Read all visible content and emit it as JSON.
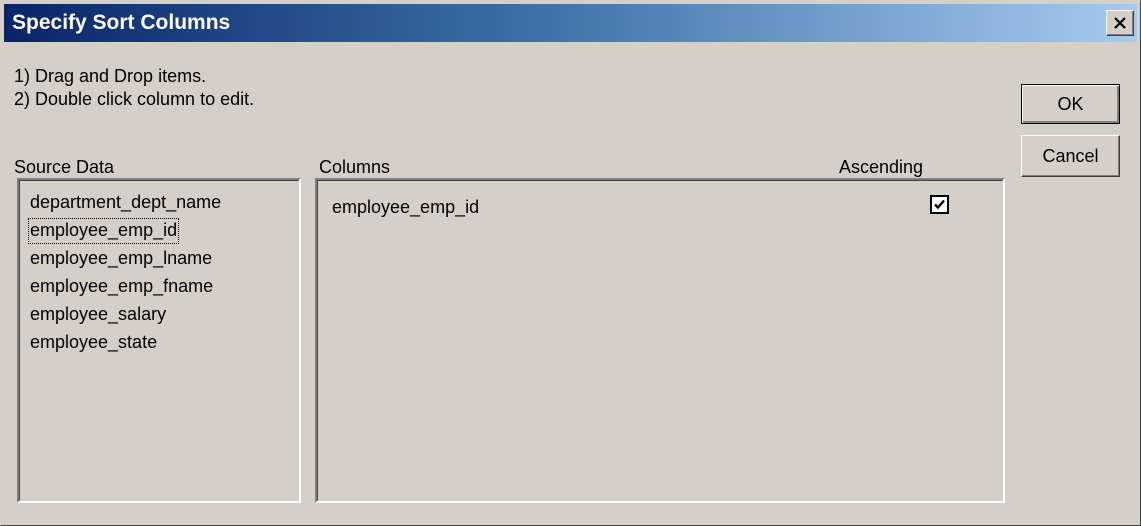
{
  "window": {
    "title": "Specify Sort Columns"
  },
  "instructions": [
    "1) Drag and Drop items.",
    "2) Double click column to edit."
  ],
  "labels": {
    "source_data": "Source Data",
    "columns": "Columns",
    "ascending": "Ascending"
  },
  "source_items": [
    "department_dept_name",
    "employee_emp_id",
    "employee_emp_lname",
    "employee_emp_fname",
    "employee_salary",
    "employee_state"
  ],
  "focused_source_index": 1,
  "sort_columns": [
    {
      "name": "employee_emp_id",
      "ascending": true
    }
  ],
  "buttons": {
    "ok": "OK",
    "cancel": "Cancel"
  },
  "colors": {
    "title_gradient_start": "#0a246a",
    "title_gradient_end": "#a6caf0",
    "face": "#d4d0c8"
  }
}
